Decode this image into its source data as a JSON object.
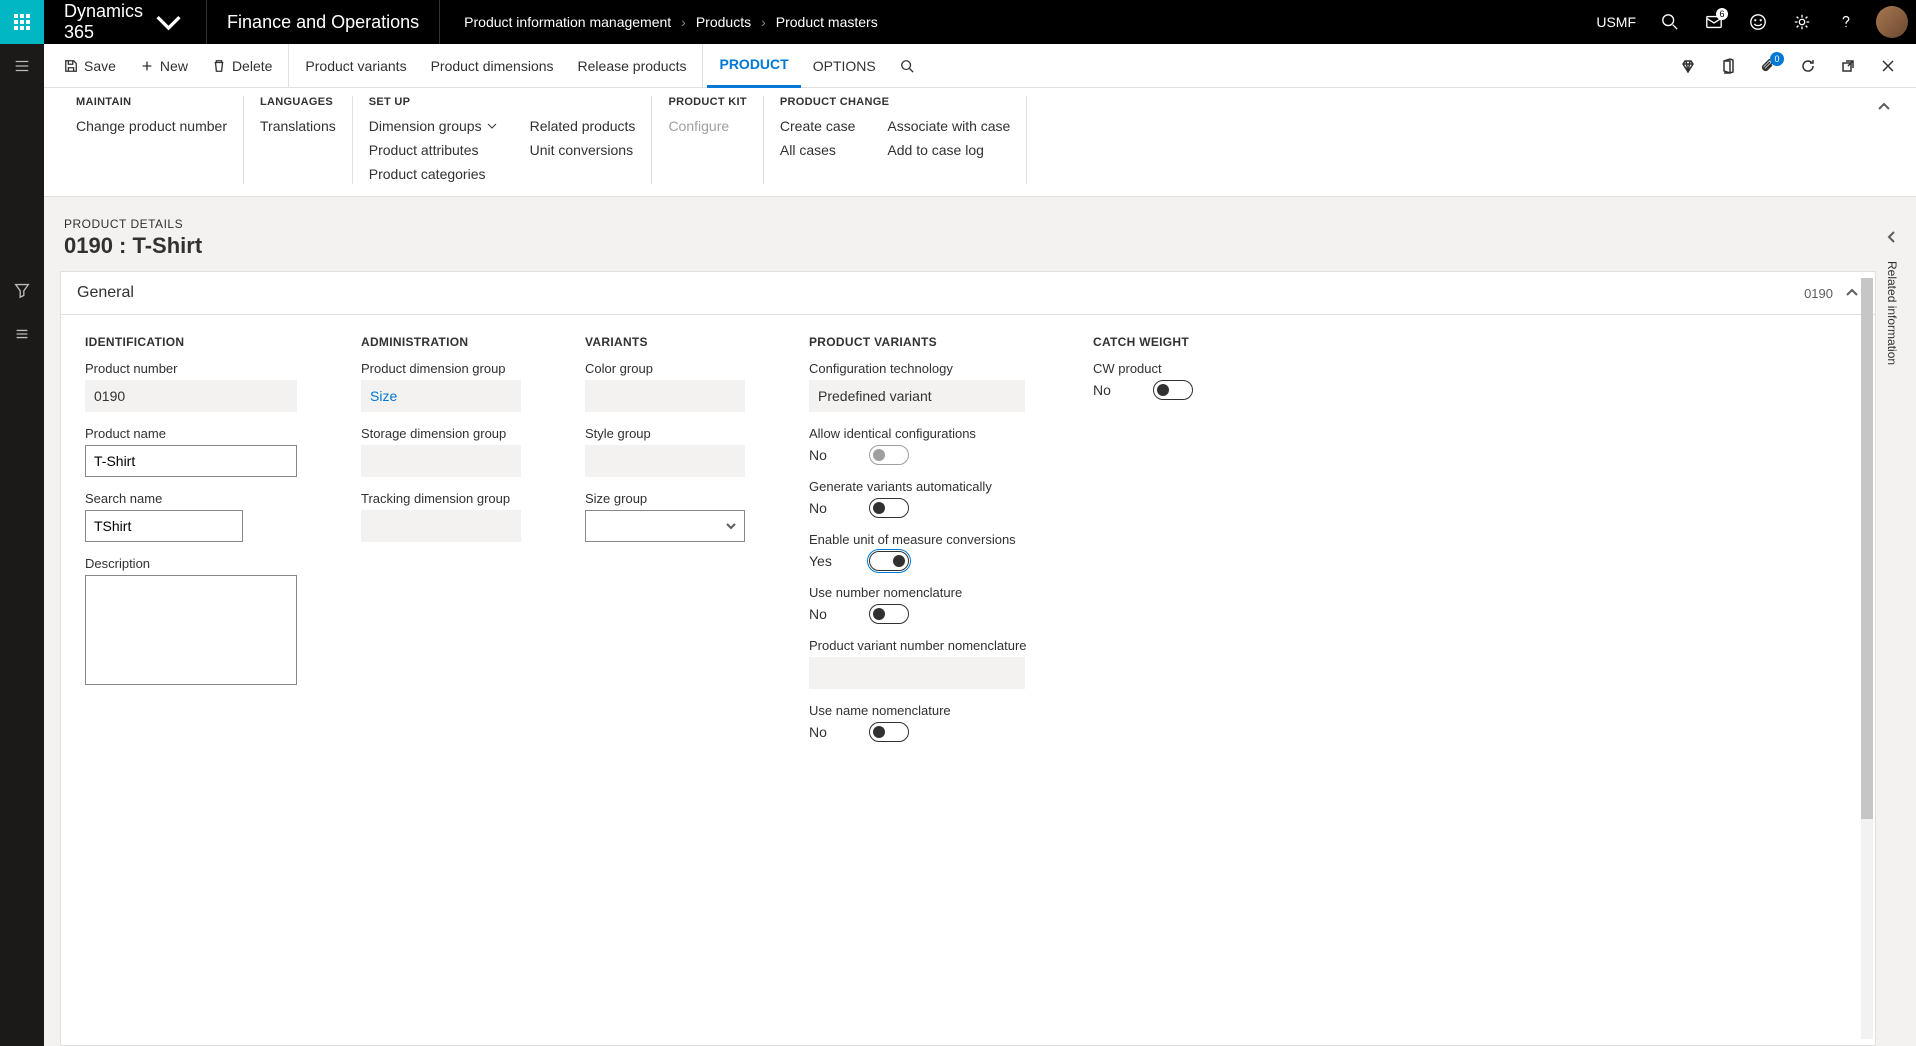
{
  "topbar": {
    "brand": "Dynamics 365",
    "app": "Finance and Operations",
    "breadcrumb": [
      "Product information management",
      "Products",
      "Product masters"
    ],
    "company": "USMF",
    "msg_badge": "6"
  },
  "actionbar": {
    "save": "Save",
    "new": "New",
    "delete": "Delete",
    "items": [
      "Product variants",
      "Product dimensions",
      "Release products"
    ],
    "tabs": {
      "product": "PRODUCT",
      "options": "OPTIONS"
    },
    "attach_badge": "0"
  },
  "ribbon": {
    "maintain": {
      "title": "MAINTAIN",
      "links": [
        "Change product number"
      ]
    },
    "languages": {
      "title": "LANGUAGES",
      "links": [
        "Translations"
      ]
    },
    "setup": {
      "title": "SET UP",
      "col1": [
        "Dimension groups",
        "Product attributes",
        "Product categories"
      ],
      "col2": [
        "Related products",
        "Unit conversions"
      ]
    },
    "kit": {
      "title": "PRODUCT KIT",
      "links": [
        "Configure"
      ]
    },
    "change": {
      "title": "PRODUCT CHANGE",
      "col1": [
        "Create case",
        "All cases"
      ],
      "col2": [
        "Associate with case",
        "Add to case log"
      ]
    }
  },
  "page": {
    "sub": "PRODUCT DETAILS",
    "title": "0190 : T-Shirt"
  },
  "fasttab": {
    "general": {
      "title": "General",
      "summary": "0190"
    }
  },
  "identification": {
    "title": "IDENTIFICATION",
    "product_number": {
      "label": "Product number",
      "value": "0190"
    },
    "product_name": {
      "label": "Product name",
      "value": "T-Shirt"
    },
    "search_name": {
      "label": "Search name",
      "value": "TShirt"
    },
    "description": {
      "label": "Description",
      "value": ""
    }
  },
  "administration": {
    "title": "ADMINISTRATION",
    "pdg": {
      "label": "Product dimension group",
      "value": "Size"
    },
    "sdg": {
      "label": "Storage dimension group",
      "value": ""
    },
    "tdg": {
      "label": "Tracking dimension group",
      "value": ""
    }
  },
  "variants": {
    "title": "VARIANTS",
    "color": {
      "label": "Color group",
      "value": ""
    },
    "style": {
      "label": "Style group",
      "value": ""
    },
    "size": {
      "label": "Size group",
      "value": ""
    }
  },
  "product_variants": {
    "title": "PRODUCT VARIANTS",
    "config_tech": {
      "label": "Configuration technology",
      "value": "Predefined variant"
    },
    "allow_identical": {
      "label": "Allow identical configurations",
      "value": "No",
      "on": false
    },
    "generate_auto": {
      "label": "Generate variants automatically",
      "value": "No",
      "on": false
    },
    "enable_uom": {
      "label": "Enable unit of measure conversions",
      "value": "Yes",
      "on": true
    },
    "use_num_nom": {
      "label": "Use number nomenclature",
      "value": "No",
      "on": false
    },
    "pvn_nom": {
      "label": "Product variant number nomenclature",
      "value": ""
    },
    "use_name_nom": {
      "label": "Use name nomenclature",
      "value": "No",
      "on": false
    }
  },
  "catch_weight": {
    "title": "CATCH WEIGHT",
    "cw": {
      "label": "CW product",
      "value": "No",
      "on": false
    }
  },
  "right_rail": {
    "label": "Related information"
  }
}
